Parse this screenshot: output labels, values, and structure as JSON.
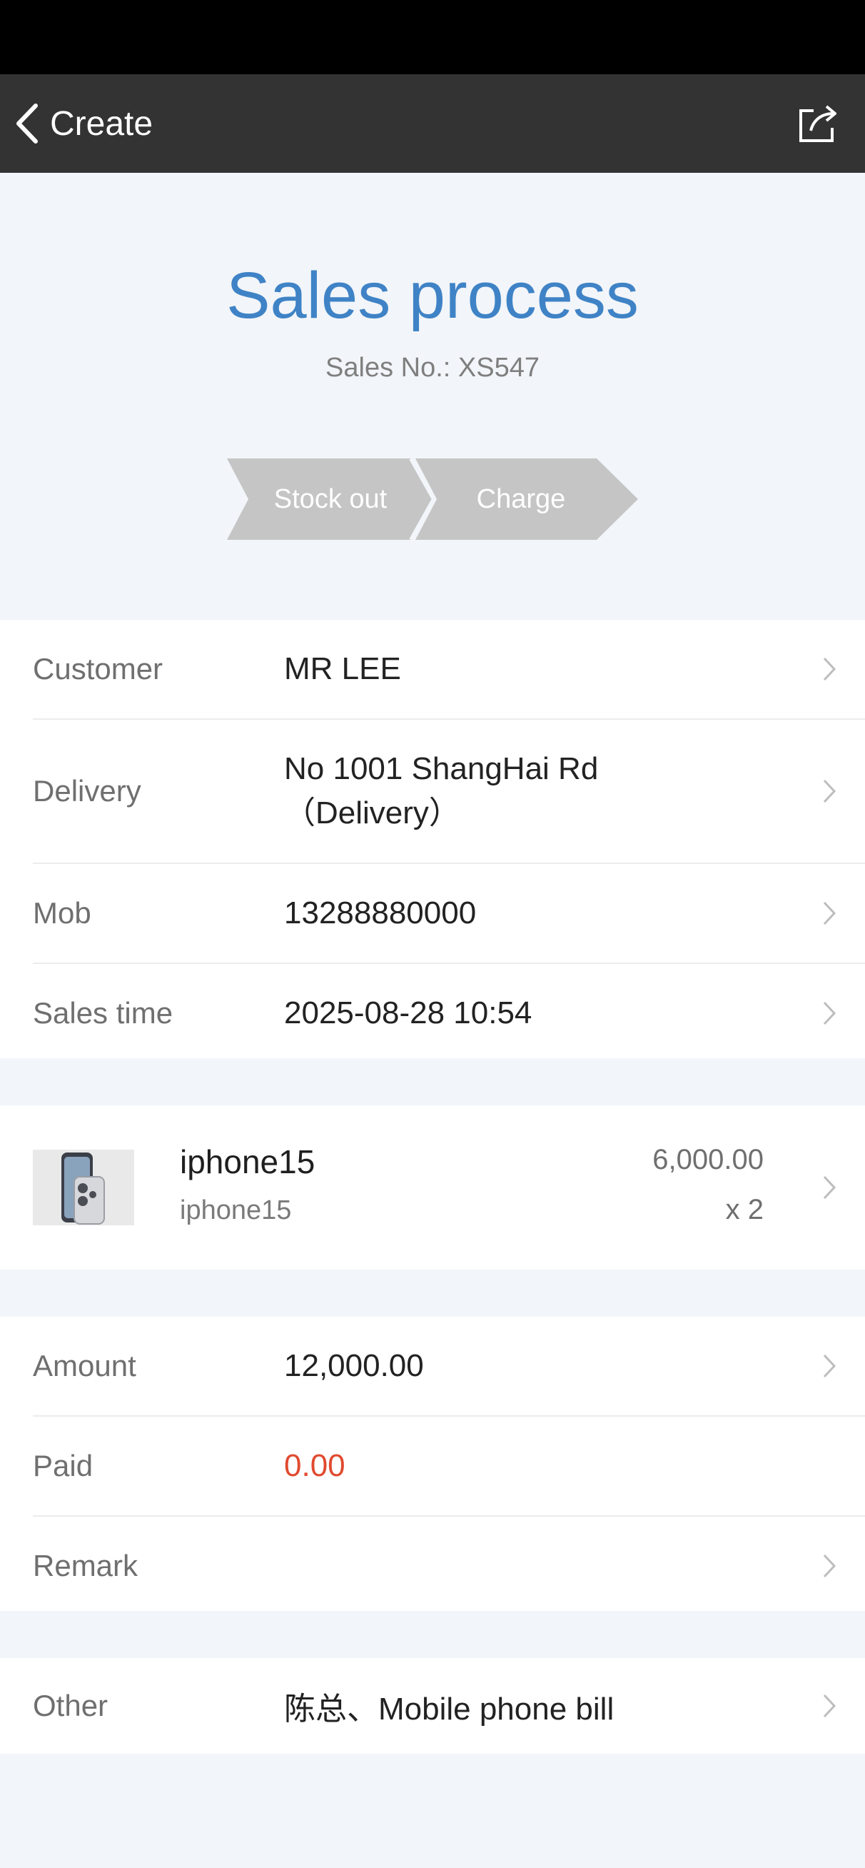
{
  "nav": {
    "back_label": "Create",
    "back_icon": "chevron-left-icon",
    "share_icon": "share-icon"
  },
  "header": {
    "title": "Sales process",
    "sales_no_label": "Sales No.:",
    "sales_no_value": "XS547",
    "steps": [
      "Stock out",
      "Charge"
    ]
  },
  "info": {
    "customer_label": "Customer",
    "customer_value": "MR LEE",
    "delivery_label": "Delivery",
    "delivery_line1": "No 1001 ShangHai Rd",
    "delivery_line2": "（Delivery）",
    "mob_label": "Mob",
    "mob_value": "13288880000",
    "sales_time_label": "Sales time",
    "sales_time_value": "2025-08-28 10:54"
  },
  "product": {
    "name": "iphone15",
    "subtitle": "iphone15",
    "price": "6,000.00",
    "quantity": "x 2"
  },
  "payment": {
    "amount_label": "Amount",
    "amount_value": "12,000.00",
    "paid_label": "Paid",
    "paid_value": "0.00",
    "remark_label": "Remark",
    "remark_value": ""
  },
  "other": {
    "label": "Other",
    "value": "陈总、Mobile phone bill"
  },
  "colors": {
    "title": "#3f83c6",
    "nav_bg": "#333333",
    "paid_value": "#e04a2f",
    "step_bg": "#c5c5c5"
  }
}
